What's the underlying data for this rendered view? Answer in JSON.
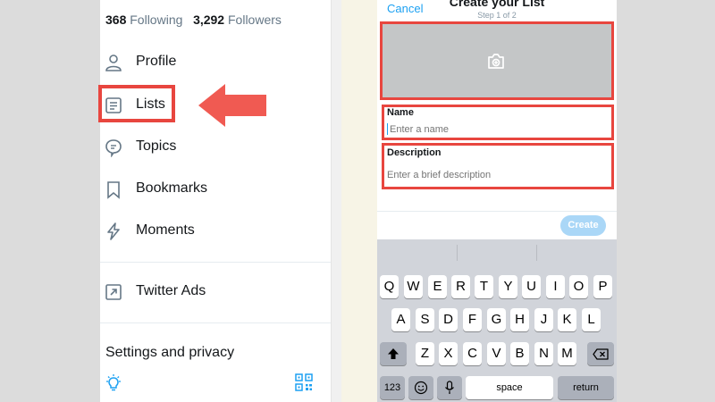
{
  "left_panel": {
    "following_count": "368",
    "following_label": "Following",
    "followers_count": "3,292",
    "followers_label": "Followers",
    "menu": [
      {
        "label": "Profile",
        "icon": "person-icon"
      },
      {
        "label": "Lists",
        "icon": "list-icon"
      },
      {
        "label": "Topics",
        "icon": "topic-bubble-icon"
      },
      {
        "label": "Bookmarks",
        "icon": "bookmark-icon"
      },
      {
        "label": "Moments",
        "icon": "lightning-icon"
      }
    ],
    "ads_label": "Twitter Ads",
    "settings_label": "Settings and privacy"
  },
  "right_panel": {
    "cancel_label": "Cancel",
    "title": "Create your List",
    "step": "Step 1 of 2",
    "name_label": "Name",
    "name_placeholder": "Enter a name",
    "description_label": "Description",
    "description_placeholder": "Enter a brief description",
    "create_label": "Create"
  },
  "keyboard": {
    "row1": [
      "Q",
      "W",
      "E",
      "R",
      "T",
      "Y",
      "U",
      "I",
      "O",
      "P"
    ],
    "row2": [
      "A",
      "S",
      "D",
      "F",
      "G",
      "H",
      "J",
      "K",
      "L"
    ],
    "row3": [
      "Z",
      "X",
      "C",
      "V",
      "B",
      "N",
      "M"
    ],
    "numbers_label": "123",
    "space_label": "space",
    "return_label": "return"
  },
  "colors": {
    "highlight": "#e8463f",
    "accent": "#1da1f2",
    "create_disabled": "#aad7f7"
  }
}
